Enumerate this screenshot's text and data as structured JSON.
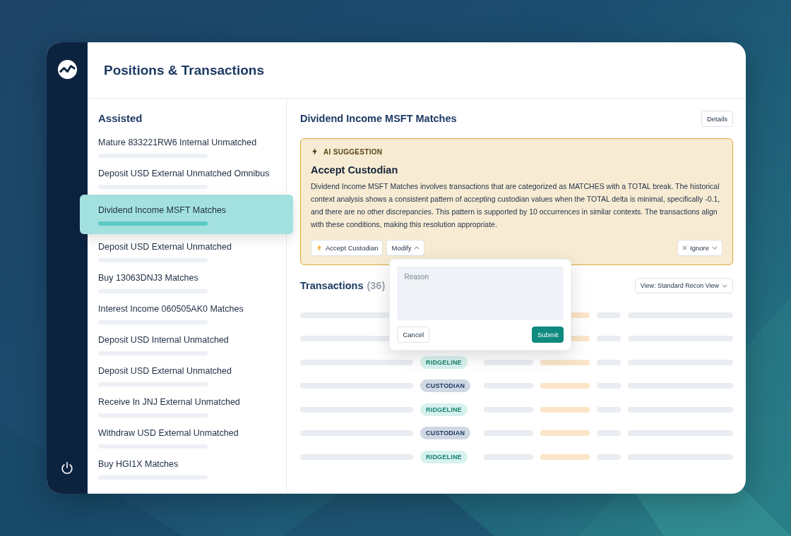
{
  "window": {
    "title": "Positions & Transactions"
  },
  "sidebar": {
    "heading": "Assisted",
    "items": [
      {
        "label": "Mature 833221RW6 Internal Unmatched",
        "selected": false
      },
      {
        "label": "Deposit USD External Unmatched Omnibus",
        "selected": false
      },
      {
        "label": "Dividend Income MSFT Matches",
        "selected": true
      },
      {
        "label": "Deposit USD External Unmatched",
        "selected": false
      },
      {
        "label": "Buy 13063DNJ3 Matches",
        "selected": false
      },
      {
        "label": "Interest Income 060505AK0 Matches",
        "selected": false
      },
      {
        "label": "Deposit USD Internal Unmatched",
        "selected": false
      },
      {
        "label": "Deposit USD External Unmatched",
        "selected": false
      },
      {
        "label": "Receive In JNJ External Unmatched",
        "selected": false
      },
      {
        "label": "Withdraw USD External Unmatched",
        "selected": false
      },
      {
        "label": "Buy HGI1X Matches",
        "selected": false
      }
    ]
  },
  "detail": {
    "title": "Dividend Income MSFT Matches",
    "details_button": "Details",
    "suggestion": {
      "tag": "AI SUGGESTION",
      "title": "Accept Custodian",
      "body": "Dividend Income MSFT Matches involves transactions that are categorized as MATCHES with a TOTAL break. The historical context analysis shows a consistent pattern of accepting custodian values when the TOTAL delta is minimal, specifically -0.1, and there are no other discrepancies. This pattern is supported by 10 occurrences in similar contexts. The transactions align with these conditions, making this resolution appropriate.",
      "accept_button": "Accept Custodian",
      "modify_button": "Modify",
      "modify_expanded": true,
      "ignore_button": "Ignore"
    },
    "popover": {
      "placeholder": "Reason",
      "cancel": "Cancel",
      "submit": "Submit"
    },
    "transactions": {
      "title": "Transactions",
      "count": "(36)",
      "view_select": "View: Standard Recon View",
      "rows": [
        {
          "source": null
        },
        {
          "source": null
        },
        {
          "source": {
            "kind": "ridgeline",
            "label": "RIDGELINE"
          }
        },
        {
          "source": {
            "kind": "custodian",
            "label": "CUSTODIAN"
          }
        },
        {
          "source": {
            "kind": "ridgeline",
            "label": "RIDGELINE"
          }
        },
        {
          "source": {
            "kind": "custodian",
            "label": "CUSTODIAN"
          }
        },
        {
          "source": {
            "kind": "ridgeline",
            "label": "RIDGELINE"
          }
        }
      ]
    }
  }
}
